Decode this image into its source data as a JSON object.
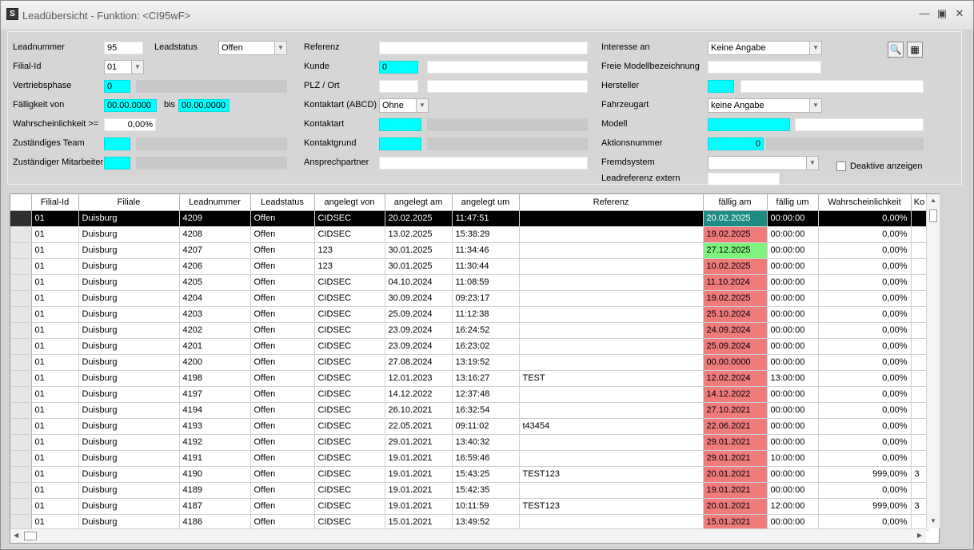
{
  "window": {
    "title": "Leadübersicht - Funktion: <CI95wF>",
    "icon": "S"
  },
  "filters": {
    "leadnummer": {
      "label": "Leadnummer",
      "value": "95"
    },
    "leadstatus": {
      "label": "Leadstatus",
      "value": "Offen"
    },
    "filial_id": {
      "label": "Filial-Id",
      "value": "01"
    },
    "vertriebsphase": {
      "label": "Vertriebsphase",
      "value": "0"
    },
    "faelligkeit_von": {
      "label": "Fälligkeit von",
      "value": "00.00.0000"
    },
    "faelligkeit_bis": {
      "label": "bis",
      "value": "00.00.0000"
    },
    "wahrscheinlichkeit": {
      "label": "Wahrscheinlichkeit >=",
      "value": "0,00%"
    },
    "team": {
      "label": "Zuständiges Team"
    },
    "mitarbeiter": {
      "label": "Zuständiger Mitarbeiter"
    },
    "referenz": {
      "label": "Referenz",
      "value": ""
    },
    "kunde": {
      "label": "Kunde",
      "value": "0"
    },
    "plz_ort": {
      "label": "PLZ / Ort"
    },
    "kontaktart_abcd": {
      "label": "Kontaktart (ABCD)",
      "value": "Ohne"
    },
    "kontaktart": {
      "label": "Kontaktart"
    },
    "kontaktgrund": {
      "label": "Kontaktgrund"
    },
    "ansprechpartner": {
      "label": "Ansprechpartner"
    },
    "interesse_an": {
      "label": "Interesse an",
      "value": "Keine Angabe"
    },
    "freie_modell": {
      "label": "Freie Modellbezeichnung"
    },
    "hersteller": {
      "label": "Hersteller"
    },
    "fahrzeugart": {
      "label": "Fahrzeugart",
      "value": "keine Angabe"
    },
    "modell": {
      "label": "Modell"
    },
    "aktionsnummer": {
      "label": "Aktionsnummer",
      "value": "0"
    },
    "fremdsystem": {
      "label": "Fremdsystem",
      "value": ""
    },
    "leadreferenz_extern": {
      "label": "Leadreferenz extern"
    },
    "deaktive": {
      "label": "Deaktive anzeigen"
    }
  },
  "grid": {
    "columns": [
      "Filial-Id",
      "Filiale",
      "Leadnummer",
      "Leadstatus",
      "angelegt von",
      "angelegt am",
      "angelegt um",
      "Referenz",
      "fällig am",
      "fällig um",
      "Wahrscheinlichkeit",
      "Ko"
    ],
    "rows": [
      [
        "01",
        "Duisburg",
        "4209",
        "Offen",
        "CIDSEC",
        "20.02.2025",
        "11:47:51",
        "",
        "20.02.2025",
        "00:00:00",
        "0,00%",
        ""
      ],
      [
        "01",
        "Duisburg",
        "4208",
        "Offen",
        "CIDSEC",
        "13.02.2025",
        "15:38:29",
        "",
        "19.02.2025",
        "00:00:00",
        "0,00%",
        ""
      ],
      [
        "01",
        "Duisburg",
        "4207",
        "Offen",
        "123",
        "30.01.2025",
        "11:34:46",
        "",
        "27.12.2025",
        "00:00:00",
        "0,00%",
        ""
      ],
      [
        "01",
        "Duisburg",
        "4206",
        "Offen",
        "123",
        "30.01.2025",
        "11:30:44",
        "",
        "10.02.2025",
        "00:00:00",
        "0,00%",
        ""
      ],
      [
        "01",
        "Duisburg",
        "4205",
        "Offen",
        "CIDSEC",
        "04.10.2024",
        "11:08:59",
        "",
        "11.10.2024",
        "00:00:00",
        "0,00%",
        ""
      ],
      [
        "01",
        "Duisburg",
        "4204",
        "Offen",
        "CIDSEC",
        "30.09.2024",
        "09:23:17",
        "",
        "19.02.2025",
        "00:00:00",
        "0,00%",
        ""
      ],
      [
        "01",
        "Duisburg",
        "4203",
        "Offen",
        "CIDSEC",
        "25.09.2024",
        "11:12:38",
        "",
        "25.10.2024",
        "00:00:00",
        "0,00%",
        ""
      ],
      [
        "01",
        "Duisburg",
        "4202",
        "Offen",
        "CIDSEC",
        "23.09.2024",
        "16:24:52",
        "",
        "24.09.2024",
        "00:00:00",
        "0,00%",
        ""
      ],
      [
        "01",
        "Duisburg",
        "4201",
        "Offen",
        "CIDSEC",
        "23.09.2024",
        "16:23:02",
        "",
        "25.09.2024",
        "00:00:00",
        "0,00%",
        ""
      ],
      [
        "01",
        "Duisburg",
        "4200",
        "Offen",
        "CIDSEC",
        "27.08.2024",
        "13:19:52",
        "",
        "00.00.0000",
        "00:00:00",
        "0,00%",
        ""
      ],
      [
        "01",
        "Duisburg",
        "4198",
        "Offen",
        "CIDSEC",
        "12.01.2023",
        "13:16:27",
        "TEST",
        "12.02.2024",
        "13:00:00",
        "0,00%",
        ""
      ],
      [
        "01",
        "Duisburg",
        "4197",
        "Offen",
        "CIDSEC",
        "14.12.2022",
        "12:37:48",
        "",
        "14.12.2022",
        "00:00:00",
        "0,00%",
        ""
      ],
      [
        "01",
        "Duisburg",
        "4194",
        "Offen",
        "CIDSEC",
        "26.10.2021",
        "16:32:54",
        "",
        "27.10.2021",
        "00:00:00",
        "0,00%",
        ""
      ],
      [
        "01",
        "Duisburg",
        "4193",
        "Offen",
        "CIDSEC",
        "22.05.2021",
        "09:11:02",
        "t43454",
        "22.06.2021",
        "00:00:00",
        "0,00%",
        ""
      ],
      [
        "01",
        "Duisburg",
        "4192",
        "Offen",
        "CIDSEC",
        "29.01.2021",
        "13:40:32",
        "",
        "29.01.2021",
        "00:00:00",
        "0,00%",
        ""
      ],
      [
        "01",
        "Duisburg",
        "4191",
        "Offen",
        "CIDSEC",
        "19.01.2021",
        "16:59:46",
        "",
        "29.01.2021",
        "10:00:00",
        "0,00%",
        ""
      ],
      [
        "01",
        "Duisburg",
        "4190",
        "Offen",
        "CIDSEC",
        "19.01.2021",
        "15:43:25",
        "TEST123",
        "20.01.2021",
        "00:00:00",
        "999,00%",
        "3"
      ],
      [
        "01",
        "Duisburg",
        "4189",
        "Offen",
        "CIDSEC",
        "19.01.2021",
        "15:42:35",
        "",
        "19.01.2021",
        "00:00:00",
        "0,00%",
        ""
      ],
      [
        "01",
        "Duisburg",
        "4187",
        "Offen",
        "CIDSEC",
        "19.01.2021",
        "10:11:59",
        "TEST123",
        "20.01.2021",
        "12:00:00",
        "999,00%",
        "3"
      ],
      [
        "01",
        "Duisburg",
        "4186",
        "Offen",
        "CIDSEC",
        "15.01.2021",
        "13:49:52",
        "",
        "15.01.2021",
        "00:00:00",
        "0,00%",
        ""
      ]
    ],
    "due_status": [
      "teal",
      "red",
      "green",
      "red",
      "red",
      "red",
      "red",
      "red",
      "red",
      "red",
      "red",
      "red",
      "red",
      "red",
      "red",
      "red",
      "red",
      "red",
      "red",
      "red"
    ],
    "selected_row": 0
  },
  "colors": {
    "required_field": "#00ffff",
    "due_overdue": "#f07b7b",
    "due_future": "#7ef47e",
    "due_selected": "#1d8c84",
    "selection_row": "#000000"
  },
  "icons": {
    "search": "magnifier-icon",
    "export": "table-export-icon"
  }
}
